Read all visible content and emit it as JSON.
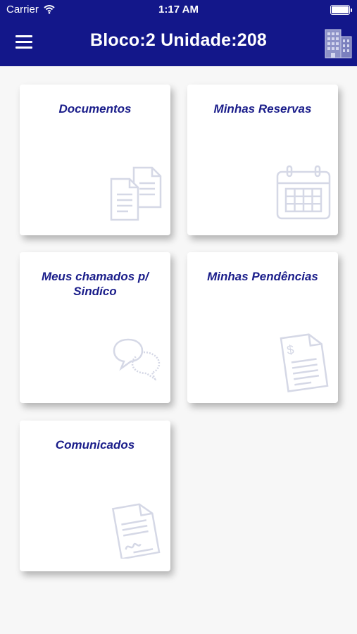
{
  "status_bar": {
    "carrier": "Carrier",
    "time": "1:17 AM"
  },
  "header": {
    "title": "Bloco:2 Unidade:208"
  },
  "colors": {
    "header": "#13178a",
    "title_text": "#1a1d8a",
    "icon": "#d5d8e6"
  },
  "cards": [
    {
      "title": "Documentos",
      "icon": "documents-icon"
    },
    {
      "title": "Minhas Reservas",
      "icon": "calendar-icon"
    },
    {
      "title": "Meus chamados p/ Sindíco",
      "icon": "chat-bubbles-icon"
    },
    {
      "title": "Minhas Pendências",
      "icon": "invoice-icon"
    },
    {
      "title": "Comunicados",
      "icon": "signed-document-icon"
    }
  ]
}
